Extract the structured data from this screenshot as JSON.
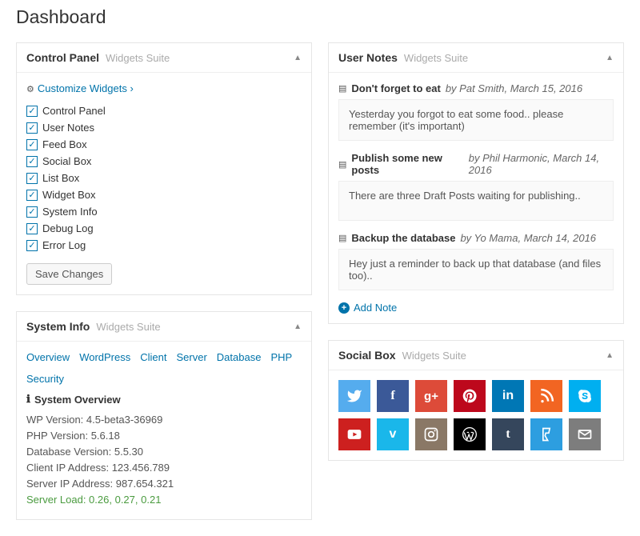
{
  "page_title": "Dashboard",
  "suite_label": "Widgets Suite",
  "control_panel": {
    "title": "Control Panel",
    "customize_link": "Customize Widgets ›",
    "items": [
      "Control Panel",
      "User Notes",
      "Feed Box",
      "Social Box",
      "List Box",
      "Widget Box",
      "System Info",
      "Debug Log",
      "Error Log"
    ],
    "save_label": "Save Changes"
  },
  "system_info": {
    "title": "System Info",
    "tabs": [
      "Overview",
      "WordPress",
      "Client",
      "Server",
      "Database",
      "PHP",
      "Security"
    ],
    "overview_title": "System Overview",
    "lines": {
      "wp": "WP Version: 4.5-beta3-36969",
      "php": "PHP Version: 5.6.18",
      "db": "Database Version: 5.5.30",
      "client_ip": "Client IP Address: 123.456.789",
      "server_ip": "Server IP Address: 987.654.321",
      "load_label": "Server Load: ",
      "load_values": [
        "0.26",
        "0.27",
        "0.21"
      ]
    }
  },
  "user_notes": {
    "title": "User Notes",
    "add_label": "Add Note",
    "notes": [
      {
        "title": "Don't forget to eat",
        "by": "by Pat Smith, March 15, 2016",
        "body": "Yesterday you forgot to eat some food.. please remember (it's important)"
      },
      {
        "title": "Publish some new posts",
        "by": "by Phil Harmonic, March 14, 2016",
        "body": "There are three Draft Posts waiting for publishing.."
      },
      {
        "title": "Backup the database",
        "by": "by Yo Mama, March 14, 2016",
        "body": "Hey just a reminder to back up that database (and files too).."
      }
    ]
  },
  "social_box": {
    "title": "Social Box",
    "icons": [
      {
        "name": "twitter",
        "color": "#55acee"
      },
      {
        "name": "facebook",
        "color": "#3b5998"
      },
      {
        "name": "googleplus",
        "color": "#dd4b39"
      },
      {
        "name": "pinterest",
        "color": "#bd081c"
      },
      {
        "name": "linkedin",
        "color": "#0077b5"
      },
      {
        "name": "rss",
        "color": "#f26522"
      },
      {
        "name": "skype",
        "color": "#00aff0"
      },
      {
        "name": "youtube",
        "color": "#cd201f"
      },
      {
        "name": "vimeo",
        "color": "#1ab7ea"
      },
      {
        "name": "instagram",
        "color": "#8a7866"
      },
      {
        "name": "wordpress",
        "color": "#000000"
      },
      {
        "name": "tumblr",
        "color": "#35465c"
      },
      {
        "name": "foursquare",
        "color": "#2d9ee0"
      },
      {
        "name": "email",
        "color": "#7d7d7d"
      }
    ]
  }
}
